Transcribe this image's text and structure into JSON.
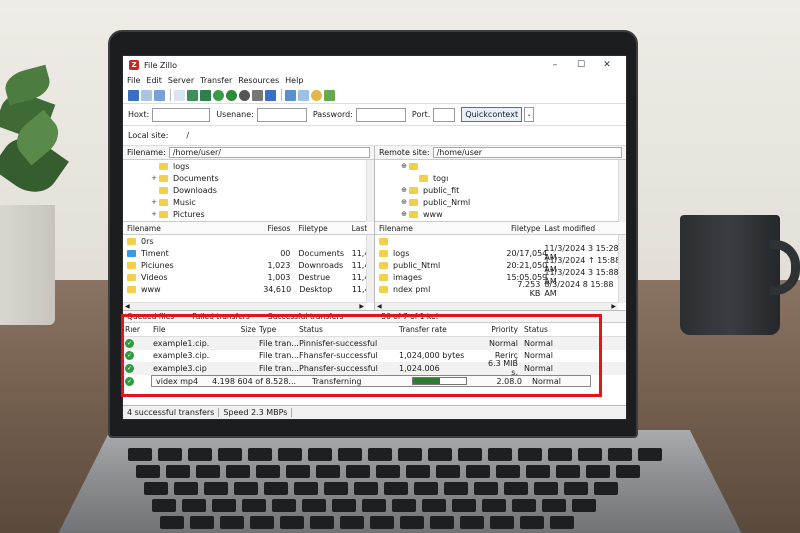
{
  "window": {
    "title": "File Zillo",
    "minimize": "–",
    "maximize": "☐",
    "close": "✕"
  },
  "menu": [
    "File",
    "Edit",
    "Server",
    "Transfer",
    "Resources",
    "Help"
  ],
  "quickconnect": {
    "host_label": "Hoxt:",
    "username_label": "Usenane:",
    "password_label": "Password:",
    "port_label": "Port.",
    "button_label": "Quickcontext",
    "dropdown": "⌄"
  },
  "local_site": {
    "label": "Local site:",
    "path": "/"
  },
  "local_pane": {
    "path_label": "Filename:",
    "path": "/home/user/",
    "tree": [
      {
        "expander": "",
        "name": "logs"
      },
      {
        "expander": "+",
        "name": "Documents"
      },
      {
        "expander": "",
        "name": "Downloads"
      },
      {
        "expander": "+",
        "name": "Music"
      },
      {
        "expander": "+",
        "name": "Pictures"
      }
    ],
    "headers": {
      "name": "Filename",
      "size": "Fiesos",
      "type": "Filetype",
      "mod": "Last"
    },
    "files": [
      {
        "name": "0rs",
        "size": "",
        "type": "",
        "mod": "",
        "icon": "folder"
      },
      {
        "name": "Timent",
        "size": "00",
        "type": "Documents",
        "mod": "11,4",
        "icon": "blue"
      },
      {
        "name": "Piciunes",
        "size": "1,023",
        "type": "Downroads",
        "mod": "11,4",
        "icon": "folder"
      },
      {
        "name": "Videos",
        "size": "1,003",
        "type": "Destrue",
        "mod": "11,4",
        "icon": "folder"
      },
      {
        "name": "www",
        "size": "34,610",
        "type": "Desktop",
        "mod": "11,4",
        "icon": "folder"
      }
    ]
  },
  "remote_pane": {
    "path_label": "Remote site:",
    "path": "/home/user",
    "tree": [
      {
        "expander": "⊕",
        "name": ""
      },
      {
        "expander": "",
        "name": "togı"
      },
      {
        "expander": "⊕",
        "name": "public_fit"
      },
      {
        "expander": "⊕",
        "name": "public_Nrml"
      },
      {
        "expander": "⊕",
        "name": "www"
      }
    ],
    "headers": {
      "name": "Filename",
      "type": "Filetype",
      "mod": "Last modified"
    },
    "files": [
      {
        "name": "",
        "type": "",
        "mod": ""
      },
      {
        "name": "logs",
        "type": "20/17,054",
        "mod": "11/3/2024 3 15:28 AM"
      },
      {
        "name": "public_Ntml",
        "type": "20:21,050",
        "mod": "11/3/2024 ↑ 15:88 AM"
      },
      {
        "name": "images",
        "type": "15:05.059",
        "mod": "11/3/2024 3 15:88 AM"
      },
      {
        "name": "ndex pml",
        "type": "7.253 KB",
        "mod": "8/3/2024 8 15:88 AM"
      }
    ],
    "summary": "50 of 7 of 1 ke!"
  },
  "queue_tabs": [
    "Queued files",
    "Failed transfers",
    "Successful transfers"
  ],
  "queue": {
    "headers": {
      "server": "Rıer",
      "file": "File",
      "size": "Size",
      "type": "Type",
      "status": "Status",
      "rate": "Transfer rate",
      "priority": "Priority",
      "status2": "Status"
    },
    "rows": [
      {
        "file": "example1.cip.",
        "size": "",
        "type": "File tran...",
        "status": "Pinnisfer-successful",
        "rate": "",
        "priority": "Normal",
        "status2": "Normal"
      },
      {
        "file": "example3.cip.",
        "size": "",
        "type": "File tran...",
        "status": "Fhansfer-successful",
        "rate": "1,024,000 bytes",
        "priority": "Rerirç",
        "status2": "Normal"
      },
      {
        "file": "example3.cip",
        "size": "",
        "type": "File tran...",
        "status": "Phansfer-successful",
        "rate": "1,024.006",
        "priority": "6.3 MIB s.",
        "status2": "Normal"
      },
      {
        "file": "videx mp4",
        "size": "4.198 604 of 8.528...",
        "type": "",
        "status": "Transferning",
        "rate": "",
        "priority": "2.08.0",
        "status2": "Normal",
        "progress": 0.5
      }
    ]
  },
  "statusbar": {
    "transfers": "4 successful transfers",
    "speed": "Speed 2.3 MBPs"
  }
}
